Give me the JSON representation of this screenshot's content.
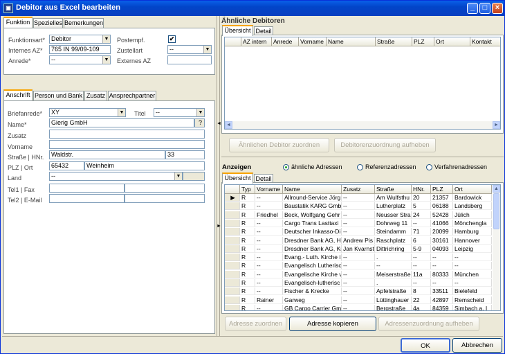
{
  "window": {
    "title": "Debitor aus Excel bearbeiten",
    "icon": "app-icon"
  },
  "top_tabs": [
    "Funktion",
    "Spezielles",
    "Bemerkungen"
  ],
  "funktion": {
    "funktionsart_label": "Funktionsart*",
    "funktionsart_value": "Debitor",
    "internes_az_label": "Internes AZ*",
    "internes_az_value": "765 IN 99/09-109",
    "anrede_label": "Anrede*",
    "anrede_value": "--",
    "postempf_label": "Postempf.",
    "postempf_checked": "✔",
    "zustellart_label": "Zustellart",
    "zustellart_value": "--",
    "externes_az_label": "Externes AZ",
    "externes_az_value": ""
  },
  "addr_tabs": [
    "Anschrift",
    "Person und Bank",
    "Zusatz",
    "Ansprechpartner"
  ],
  "anschrift": {
    "briefanrede_label": "Briefanrede*",
    "briefanrede_value": "XY",
    "titel_label": "Titel",
    "titel_value": "--",
    "name_label": "Name*",
    "name_value": "Gierig GmbH",
    "name_btn": "?",
    "zusatz_label": "Zusatz",
    "vorname_label": "Vorname",
    "strasse_label": "Straße | HNr.",
    "strasse_value": "Waldstr.",
    "hnr_value": "33",
    "plz_label": "PLZ | Ort",
    "plz_value": "65432",
    "ort_value": "Weinheim",
    "land_label": "Land",
    "land_value": "--",
    "tel_label": "Tel1 | Fax",
    "tel2_label": "Tel2 | E-Mail"
  },
  "similar": {
    "title": "Ähnliche Debitoren",
    "tabs": [
      "Übersicht",
      "Detail"
    ],
    "columns": [
      "AZ intern",
      "Anrede",
      "Vorname",
      "Name",
      "Straße",
      "PLZ",
      "Ort",
      "Kontakt"
    ],
    "btn_assign": "Ähnlichen Debitor zuordnen",
    "btn_remove": "Debitorenzuordnung aufheben"
  },
  "show": {
    "label": "Anzeigen",
    "radios": [
      "ähnliche Adressen",
      "Referenzadressen",
      "Verfahrenadressen"
    ],
    "tabs": [
      "Übersicht",
      "Detail"
    ],
    "columns": [
      "Typ",
      "Vorname",
      "Name",
      "Zusatz",
      "Straße",
      "HNr.",
      "PLZ",
      "Ort"
    ],
    "rows": [
      [
        "R",
        "--",
        "Allround-Service Jörg",
        "--",
        "Am Wulfsthu",
        "20",
        "21357",
        "Bardowick"
      ],
      [
        "R",
        "--",
        "Baustatik KARG Gmb",
        "--",
        "Lutherplatz",
        "5",
        "06188",
        "Landsberg"
      ],
      [
        "R",
        "Friedhel",
        "Beck, Wolfgang Gehr",
        "--",
        "Neusser Stra",
        "24",
        "52428",
        "Jülich"
      ],
      [
        "R",
        "--",
        "Cargo Trans Lasttaxi",
        "--",
        "Dohrweg 11",
        "--",
        "41066",
        "Mönchengla"
      ],
      [
        "R",
        "--",
        "Deutscher Inkasso-Di",
        "--",
        "Steindamm",
        "71",
        "20099",
        "Hamburg"
      ],
      [
        "R",
        "--",
        "Dresdner Bank AG, H",
        "Andrew Pis",
        "Raschplatz",
        "6",
        "30161",
        "Hannover"
      ],
      [
        "R",
        "--",
        "Dresdner Bank AG, Kr",
        "Jan Kvarnst",
        "Dittrichring",
        "5-9",
        "04093",
        "Leipzig"
      ],
      [
        "R",
        "--",
        "Evang.- Luth. Kirche i",
        "--",
        ".",
        "--",
        "--",
        "--"
      ],
      [
        "R",
        "--",
        "Evangelisch Lutherisc",
        "--",
        "--",
        "--",
        "--",
        "--"
      ],
      [
        "R",
        "--",
        "Evangelische Kirche v",
        "--",
        "Meiserstraße",
        "11a",
        "80333",
        "München"
      ],
      [
        "R",
        "--",
        "Evangelisch-lutherisc",
        "--",
        ".",
        "--",
        "--",
        "--"
      ],
      [
        "R",
        "--",
        "Fischer & Krecke",
        "--",
        "Apfelstraße",
        "8",
        "33511",
        "Bielefeld"
      ],
      [
        "R",
        "Rainer",
        "Garweg",
        "--",
        "Lüttinghauer",
        "22",
        "42897",
        "Remscheid"
      ],
      [
        "R",
        "--",
        "GB Cargo Carrier Gm",
        "--",
        "Bergstraße",
        "4a",
        "84359",
        "Simbach a. I"
      ]
    ],
    "btn_assign": "Adresse zuordnen",
    "btn_copy": "Adresse kopieren",
    "btn_remove": "Adressenzuordnung aufheben"
  },
  "footer": {
    "ok": "OK",
    "cancel": "Abbrechen"
  }
}
